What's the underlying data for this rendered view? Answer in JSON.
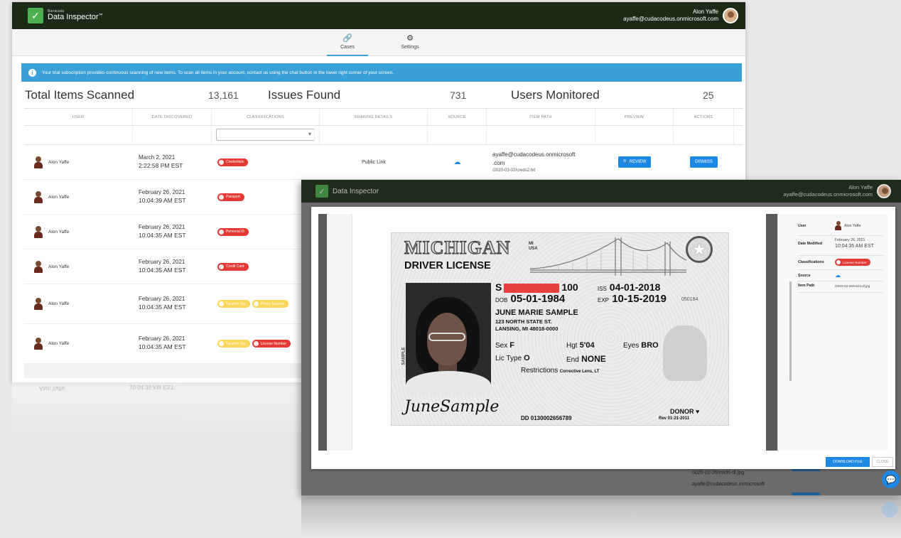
{
  "back": {
    "brand_sub": "Barracuda",
    "brand_name": "Data Inspector",
    "brand_tm": "™",
    "user_name": "Alon Yaffe",
    "user_email": "ayaffe@cudacodeus.onmicrosoft.com",
    "tabs": [
      {
        "label": "Cases",
        "icon": "link-icon"
      },
      {
        "label": "Settings",
        "icon": "gear-icon"
      }
    ],
    "banner": "Your trial subscription provides continuous scanning of new items. To scan all items in your account, contact us using the chat button in the lower right corner of your screen.",
    "stats": {
      "total_label": "Total Items Scanned",
      "total_value": "13,161",
      "issues_label": "Issues Found",
      "issues_value": "731",
      "users_label": "Users Monitored",
      "users_value": "25"
    },
    "columns": [
      "USER",
      "DATE DISCOVERED",
      "CLASSIFICATIONS",
      "SHARING DETAILS",
      "SOURCE",
      "ITEM PATH",
      "PREVIEW",
      "ACTIONS"
    ],
    "rows": [
      {
        "user": "Alon Yaffe",
        "date1": "March 2, 2021",
        "date2": "2:22:58 PM EST",
        "classifications": [
          {
            "label": "Credentials",
            "color": "red"
          }
        ],
        "sharing": "Public Link",
        "source": "cloud",
        "path1": "ayaffe@cudacodeus.onmicrosoft",
        "path2": ".com",
        "path3": "/2020-03-02/creds2.txt",
        "review": "REVIEW",
        "dismiss": "DISMISS"
      },
      {
        "user": "Alon Yaffe",
        "date1": "February 26, 2021",
        "date2": "10:04:39 AM EST",
        "classifications": [
          {
            "label": "Passport",
            "color": "red"
          }
        ]
      },
      {
        "user": "Alon Yaffe",
        "date1": "February 26, 2021",
        "date2": "10:04:35 AM EST",
        "classifications": [
          {
            "label": "Personal ID",
            "color": "red"
          }
        ]
      },
      {
        "user": "Alon Yaffe",
        "date1": "February 26, 2021",
        "date2": "10:04:35 AM EST",
        "classifications": [
          {
            "label": "Credit Card",
            "color": "red"
          }
        ]
      },
      {
        "user": "Alon Yaffe",
        "date1": "February 26, 2021",
        "date2": "10:04:35 AM EST",
        "classifications": [
          {
            "label": "Taxation Tax",
            "color": "yellow"
          },
          {
            "label": "Phone Number",
            "color": "yellow"
          }
        ]
      },
      {
        "user": "Alon Yaffe",
        "date1": "February 26, 2021",
        "date2": "10:04:35 AM EST",
        "classifications": [
          {
            "label": "Taxation Tax",
            "color": "yellow"
          },
          {
            "label": "License Number",
            "color": "red"
          }
        ]
      }
    ]
  },
  "front": {
    "brand_name": "Data Inspector",
    "user_name": "Alon Yaffe",
    "user_email": "ayaffe@cudacodeus.onmicrosoft.com",
    "side": {
      "user_label": "User",
      "user_value": "Alon Yaffe",
      "date_label": "Date Modified",
      "date_value1": "February 26, 2021",
      "date_value2": "10:04:35 AM EST",
      "class_label": "Classifications",
      "class_value": "License Number",
      "source_label": "Source",
      "path_label": "Item Path",
      "path_value": "/2020-02-26/michi-dl.jpg"
    },
    "buttons": {
      "primary": "DOWNLOAD FILE",
      "close": "CLOSE"
    },
    "ghost_path": "0020-02-26/michi-dl.jpg",
    "ghost_email": "ayaffe@cudacodeus.onmicrosoft"
  },
  "license": {
    "state": "MICHIGAN",
    "usa": "MI\nUSA",
    "type": "DRIVER LICENSE",
    "s_label": "S",
    "s_tail": "100",
    "iss_label": "ISS",
    "iss": "04-01-2018",
    "dob_label": "DOB",
    "dob": "05-01-1984",
    "exp_label": "EXP",
    "exp": "10-15-2019",
    "small_code": "050184",
    "name": "JUNE MARIE SAMPLE",
    "addr1": "123 NORTH STATE ST.",
    "addr2": "LANSING, MI 48018-0000",
    "sex_label": "Sex",
    "sex": "F",
    "hgt_label": "Hgt",
    "hgt": "5'04",
    "eyes_label": "Eyes",
    "eyes": "BRO",
    "lictype_label": "Lic Type",
    "lictype": "O",
    "end_label": "End",
    "end": "NONE",
    "restrictions_label": "Restrictions",
    "restrictions": "Corrective Lens, LT",
    "signature": "JuneSample",
    "dd": "DD 0130002656789",
    "donor": "DONOR ♥",
    "donor_date": "Rev 01-21-2011",
    "sample": "SAMPLE"
  }
}
